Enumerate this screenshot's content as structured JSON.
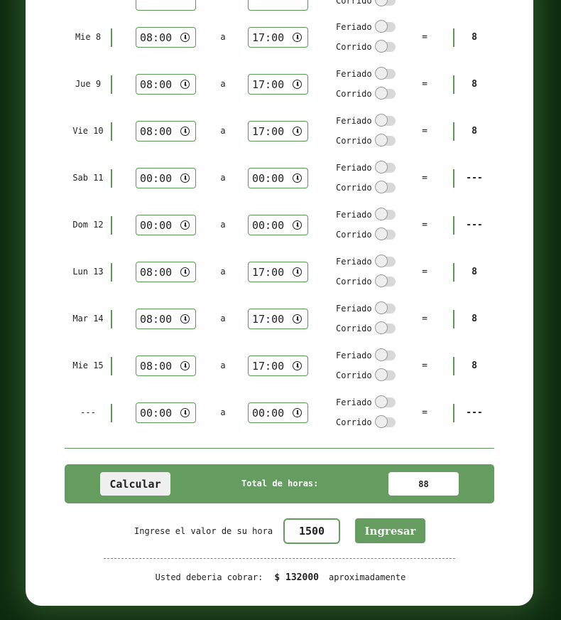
{
  "rows": [
    {
      "day": "Mie 8",
      "start": "08:00",
      "end": "17:00",
      "hours": "8"
    },
    {
      "day": "Jue 9",
      "start": "08:00",
      "end": "17:00",
      "hours": "8"
    },
    {
      "day": "Vie 10",
      "start": "08:00",
      "end": "17:00",
      "hours": "8"
    },
    {
      "day": "Sab 11",
      "start": "00:00",
      "end": "00:00",
      "hours": "---"
    },
    {
      "day": "Dom 12",
      "start": "00:00",
      "end": "00:00",
      "hours": "---"
    },
    {
      "day": "Lun 13",
      "start": "08:00",
      "end": "17:00",
      "hours": "8"
    },
    {
      "day": "Mar 14",
      "start": "08:00",
      "end": "17:00",
      "hours": "8"
    },
    {
      "day": "Mie 15",
      "start": "08:00",
      "end": "17:00",
      "hours": "8"
    },
    {
      "day": "---",
      "start": "00:00",
      "end": "00:00",
      "hours": "---"
    }
  ],
  "labels": {
    "separator": "a",
    "equals": "=",
    "feriado": "Feriado",
    "corrido": "Corrido",
    "top_partial": "Corrido"
  },
  "summary": {
    "calc_button": "Calcular",
    "total_label": "Total de horas:",
    "total_value": "88"
  },
  "rate": {
    "label": "Ingrese el valor de su hora",
    "value": "1500",
    "button": "Ingresar"
  },
  "result": {
    "prefix": "Usted deberia cobrar:",
    "amount": "$ 132000",
    "suffix": "aproximadamente"
  },
  "colors": {
    "accent": "#659c5f",
    "background": "#0d2a0f",
    "card": "#ffffff"
  }
}
